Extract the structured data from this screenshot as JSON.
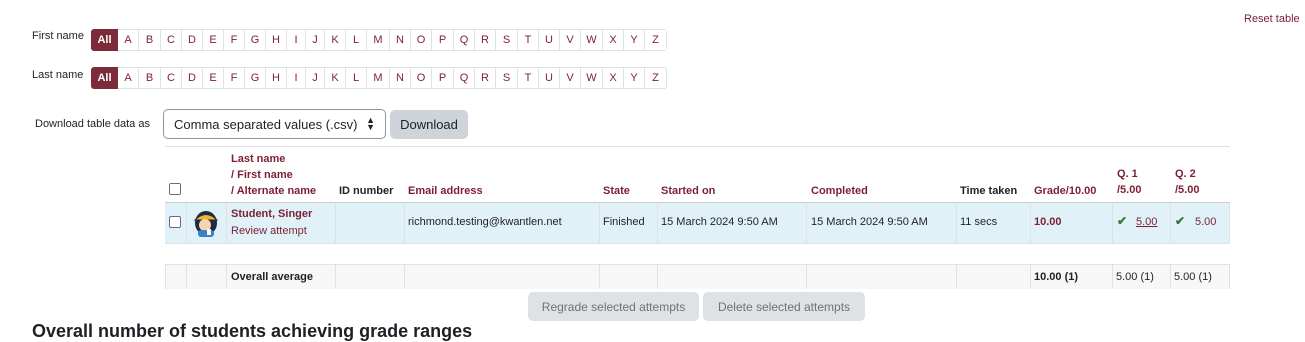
{
  "reset_table": "Reset table",
  "first_name_filter": {
    "label": "First name",
    "letters": [
      "All",
      "A",
      "B",
      "C",
      "D",
      "E",
      "F",
      "G",
      "H",
      "I",
      "J",
      "K",
      "L",
      "M",
      "N",
      "O",
      "P",
      "Q",
      "R",
      "S",
      "T",
      "U",
      "V",
      "W",
      "X",
      "Y",
      "Z"
    ]
  },
  "last_name_filter": {
    "label": "Last name",
    "letters": [
      "All",
      "A",
      "B",
      "C",
      "D",
      "E",
      "F",
      "G",
      "H",
      "I",
      "J",
      "K",
      "L",
      "M",
      "N",
      "O",
      "P",
      "Q",
      "R",
      "S",
      "T",
      "U",
      "V",
      "W",
      "X",
      "Y",
      "Z"
    ]
  },
  "download": {
    "label": "Download table data as",
    "selected": "Comma separated values (.csv)",
    "button": "Download"
  },
  "table": {
    "headers": {
      "name_line1": "Last name",
      "name_line2": "/ First name",
      "name_line3": "/ Alternate name",
      "id_number": "ID number",
      "email": "Email address",
      "state": "State",
      "started_on": "Started on",
      "completed": "Completed",
      "time_taken": "Time taken",
      "grade": "Grade/10.00",
      "q1_line1": "Q. 1",
      "q1_line2": "/5.00",
      "q2_line1": "Q. 2",
      "q2_line2": "/5.00"
    },
    "row": {
      "name": "Student, Singer",
      "review": "Review attempt",
      "email": "richmond.testing@kwantlen.net",
      "state": "Finished",
      "started_on": "15 March 2024 9:50 AM",
      "completed": "15 March 2024 9:50 AM",
      "time_taken": "11 secs",
      "grade": "10.00",
      "q1": "5.00",
      "q2": "5.00",
      "tick": "✔"
    },
    "average": {
      "label": "Overall average",
      "grade": "10.00 (1)",
      "q1": "5.00 (1)",
      "q2": "5.00 (1)"
    }
  },
  "actions": {
    "regrade": "Regrade selected attempts",
    "delete": "Delete selected attempts"
  },
  "section_heading": "Overall number of students achieving grade ranges",
  "colors": {
    "accent": "#7c2b3b",
    "link": "#7c1f34",
    "row_highlight": "#e0f1f8",
    "correct": "#357a32"
  }
}
